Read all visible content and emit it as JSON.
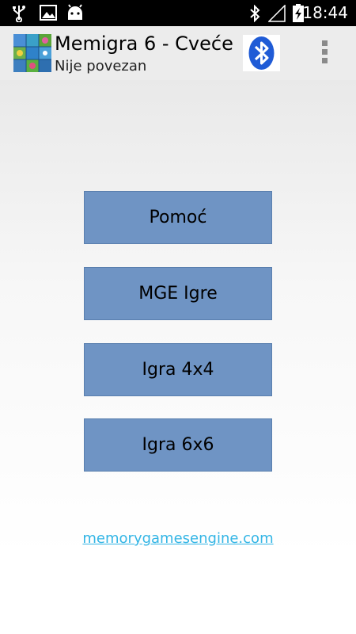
{
  "status_bar": {
    "time": "18:44",
    "left_icons": [
      "usb-icon",
      "image-icon",
      "android-icon"
    ],
    "right_icons": [
      "bluetooth-icon",
      "signal-icon",
      "battery-charging-icon"
    ]
  },
  "action_bar": {
    "title": "Memigra 6 - Cveće",
    "subtitle": "Nije povezan",
    "app_icon": "flower-memory-icon",
    "bluetooth_icon": "bluetooth-icon",
    "overflow_icon": "overflow-menu-icon"
  },
  "menu": {
    "buttons": [
      {
        "label": "Pomoć"
      },
      {
        "label": "MGE Igre"
      },
      {
        "label": "Igra 4x4"
      },
      {
        "label": "Igra 6x6"
      }
    ]
  },
  "footer": {
    "link_text": "memorygamesengine.com"
  },
  "colors": {
    "button": "#6f94c4",
    "link": "#33b5e5",
    "bluetooth": "#1f5bd6"
  }
}
